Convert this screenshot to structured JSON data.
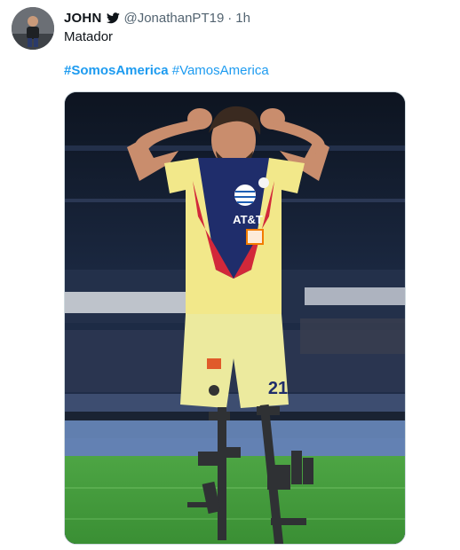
{
  "tweet": {
    "display_name": "JOHN",
    "handle": "@JonathanPT19",
    "separator": "·",
    "time": "1h",
    "text": "Matador",
    "hashtags": [
      "#SomosAmerica",
      "#VamosAmerica"
    ]
  },
  "media": {
    "jersey_sponsor": "AT&T",
    "jersey_number": "21"
  },
  "icons": {
    "bird": "twitter-bird-icon"
  },
  "colors": {
    "link": "#1d9bf0",
    "secondary_text": "#536471",
    "jersey_yellow": "#f2e88a",
    "jersey_navy": "#1f2d6b",
    "jersey_red": "#d2283a",
    "pitch_green": "#3f9a3a"
  }
}
